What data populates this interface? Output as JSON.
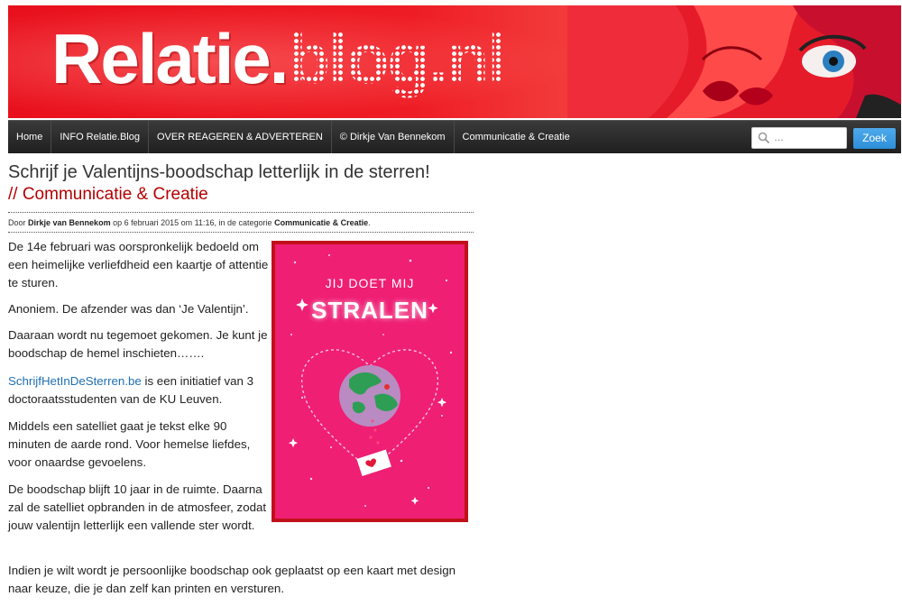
{
  "header": {
    "logo_main": "Relatie.",
    "logo_dotted": "blog.nl"
  },
  "nav": {
    "items": [
      {
        "label": "Home"
      },
      {
        "label": "INFO Relatie.Blog"
      },
      {
        "label": "OVER REAGEREN & ADVERTEREN"
      },
      {
        "label": "© Dirkje Van Bennekom"
      },
      {
        "label": "Communicatie & Creatie"
      }
    ],
    "search_placeholder": "…",
    "search_button": "Zoek"
  },
  "post": {
    "title": "Schrijf je Valentijns-boodschap letterlijk in de sterren!",
    "subtitle": "// Communicatie & Creatie",
    "meta": {
      "by": "Door",
      "author": "Dirkje van Bennekom",
      "date_text": "op 6 februari 2015 om 11:16, in de categorie",
      "category": "Communicatie & Creatie",
      "end": "."
    },
    "paragraphs": [
      "De 14e februari was oorspronkelijk bedoeld om een heimelijke verliefdheid een kaartje of attentie te sturen.",
      "Anoniem. De afzender was dan ‘Je Valentijn’.",
      "Daaraan wordt nu tegemoet gekomen. Je kunt je boodschap de hemel inschieten…….",
      " is een initiatief van 3 doctoraatsstudenten van de KU Leuven.",
      "Middels een satelliet gaat je tekst elke 90 minuten de aarde rond. Voor hemelse liefdes, voor onaardse gevoelens.",
      "De boodschap blijft 10 jaar in de ruimte. Daarna zal de satelliet opbranden in de atmosfeer, zodat jouw valentijn letterlijk een vallende ster wordt.",
      "Indien je wilt wordt je persoonlijke boodschap ook geplaatst op een kaart met design naar keuze, die je dan zelf kan printen en versturen."
    ],
    "link_text": "SchrijfHetInDeSterren.be",
    "image": {
      "line1": "JIJ DOET MIJ",
      "line2": "STRALEN"
    }
  },
  "colors": {
    "brand_red": "#ee1c24",
    "subtitle_red": "#b30000",
    "link_blue": "#1f6fb2",
    "card_pink": "#ef1f74",
    "search_blue": "#2d8fd8"
  }
}
